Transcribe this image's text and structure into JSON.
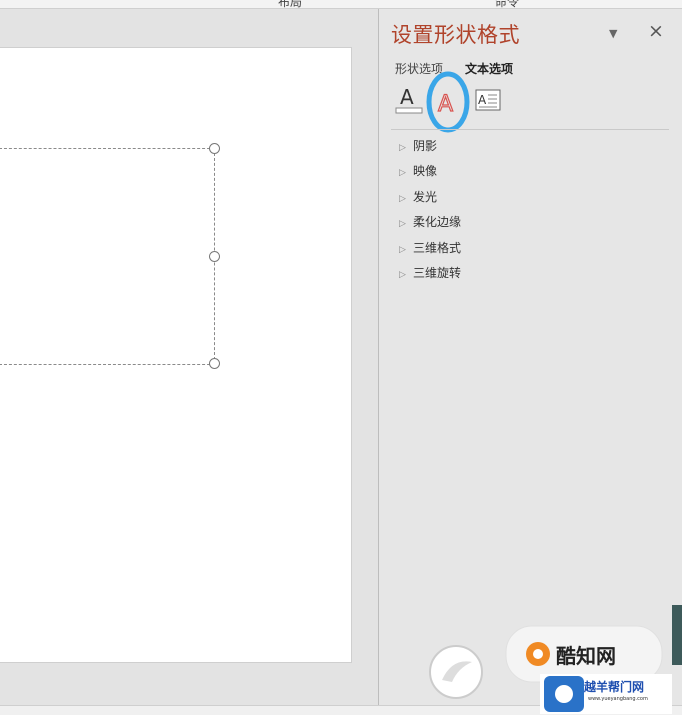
{
  "top_strip": {
    "fragment_left": "布局",
    "fragment_right": "命令"
  },
  "pane": {
    "title": "设置形状格式",
    "close": "×",
    "dropdown": "▼",
    "tabs": [
      {
        "label": "形状选项"
      },
      {
        "label": "文本选项"
      }
    ],
    "icons": [
      "text-fill-outline-icon",
      "text-effects-icon",
      "textbox-icon"
    ],
    "sections": [
      {
        "label": "阴影"
      },
      {
        "label": "映像"
      },
      {
        "label": "发光"
      },
      {
        "label": "柔化边缘"
      },
      {
        "label": "三维格式"
      },
      {
        "label": "三维旋转"
      }
    ]
  },
  "watermark": {
    "brand": "酷知网",
    "sub": "越羊帮门网",
    "url": "www.yueyangbang.com"
  },
  "colors": {
    "title": "#b0432b",
    "highlight_circle": "#3aa6e8"
  }
}
